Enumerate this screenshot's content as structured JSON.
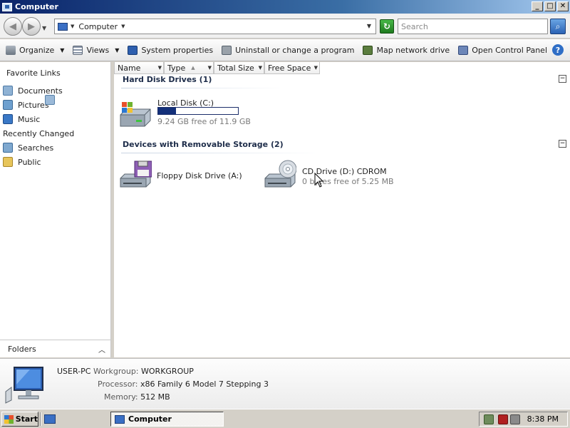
{
  "window": {
    "title": "Computer",
    "buttons": {
      "minimize": "_",
      "maximize": "□",
      "close": "✕"
    }
  },
  "address": {
    "path_label": "Computer",
    "search_placeholder": "Search"
  },
  "commands": [
    {
      "label": "Organize",
      "icon": "organize-icon"
    },
    {
      "label": "Views",
      "icon": "views-icon"
    },
    {
      "label": "System properties",
      "icon": "system-properties-icon"
    },
    {
      "label": "Uninstall or change a program",
      "icon": "uninstall-icon"
    },
    {
      "label": "Map network drive",
      "icon": "map-network-drive-icon"
    },
    {
      "label": "Open Control Panel",
      "icon": "control-panel-icon"
    }
  ],
  "sidebar": {
    "title": "Favorite Links",
    "items": [
      {
        "label": "Documents",
        "icon": "documents-icon"
      },
      {
        "label": "Pictures",
        "icon": "pictures-icon"
      },
      {
        "label": "Music",
        "icon": "music-icon"
      },
      {
        "label": "Recently Changed",
        "icon": "recently-changed-icon"
      },
      {
        "label": "Searches",
        "icon": "searches-icon"
      },
      {
        "label": "Public",
        "icon": "public-folder-icon"
      }
    ],
    "folders_label": "Folders"
  },
  "columns": [
    "Name",
    "Type",
    "Total Size",
    "Free Space"
  ],
  "groups": {
    "hard_disks": {
      "title": "Hard Disk Drives (1)",
      "drives": [
        {
          "name": "Local Disk (C:)",
          "free": "9.24 GB free of 11.9 GB",
          "used_fraction": 0.22
        }
      ]
    },
    "removable": {
      "title": "Devices with Removable Storage (2)",
      "drives": [
        {
          "name": "Floppy Disk Drive (A:)"
        },
        {
          "name": "CD Drive (D:) CDROM",
          "free": "0 bytes free of 5.25 MB"
        }
      ]
    }
  },
  "details": {
    "computer_name": "USER-PC",
    "workgroup_label": "Workgroup:",
    "workgroup": "WORKGROUP",
    "processor_label": "Processor:",
    "processor": "x86 Family 6 Model 7 Stepping 3",
    "memory_label": "Memory:",
    "memory": "512 MB"
  },
  "taskbar": {
    "start": "Start",
    "task": "Computer",
    "clock": "8:38 PM"
  }
}
